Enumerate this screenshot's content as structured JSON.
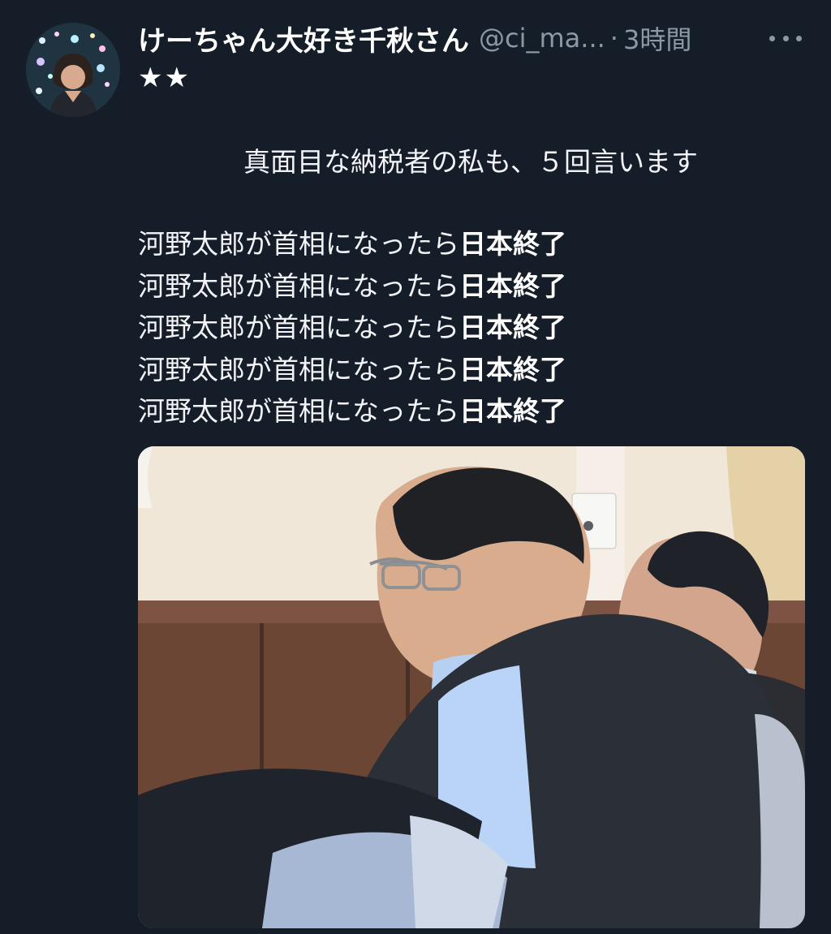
{
  "tweet": {
    "display_name": "けーちゃん大好き千秋さん",
    "handle": "@ci_ma...",
    "separator": "·",
    "timestamp": "3時間",
    "stars": "★★",
    "intro": "真面目な納税者の私も、５回言います",
    "lines": [
      {
        "prefix": "河野太郎が首相になったら",
        "emphasis": "日本終了"
      },
      {
        "prefix": "河野太郎が首相になったら",
        "emphasis": "日本終了"
      },
      {
        "prefix": "河野太郎が首相になったら",
        "emphasis": "日本終了"
      },
      {
        "prefix": "河野太郎が首相になったら",
        "emphasis": "日本終了"
      },
      {
        "prefix": "河野太郎が首相になったら",
        "emphasis": "日本終了"
      }
    ]
  },
  "icons": {
    "more": "more-options-icon"
  },
  "colors": {
    "background": "#151d29",
    "secondary_text": "#8b98a5",
    "primary_text": "#f2f4f7"
  }
}
